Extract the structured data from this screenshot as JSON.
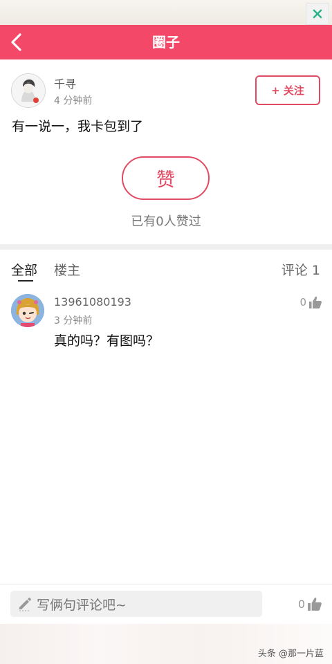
{
  "header": {
    "title": "圈子"
  },
  "post": {
    "author_name": "千寻",
    "time": "4 分钟前",
    "follow_label": "+ 关注",
    "text": "有一说一，我卡包到了",
    "like_button_label": "赞",
    "like_count_text": "已有0人赞过"
  },
  "tabs": {
    "all": "全部",
    "owner": "楼主",
    "comment_count": "评论 1"
  },
  "comments": [
    {
      "user": "13961080193",
      "time": "3 分钟前",
      "text": "真的吗？有图吗？",
      "likes": "0"
    }
  ],
  "bottom_bar": {
    "placeholder": "写俩句评论吧~",
    "likes": "0"
  },
  "watermark": "头条 @那一片蓝",
  "colors": {
    "accent": "#f34867",
    "outline": "#e04a62"
  },
  "icons": [
    "close-icon",
    "back-arrow-icon",
    "thumb-up-icon",
    "pencil-icon"
  ]
}
